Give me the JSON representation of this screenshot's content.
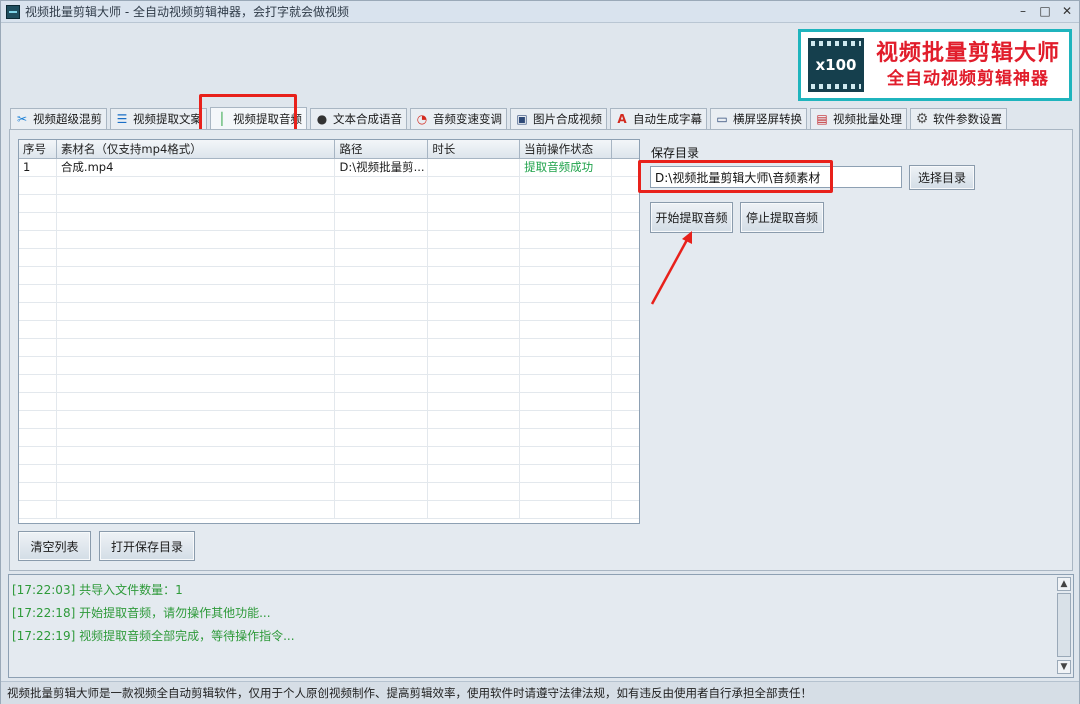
{
  "window": {
    "title": "视频批量剪辑大师 - 全自动视频剪辑神器，会打字就会做视频",
    "minimize": "–",
    "maximize": "□",
    "close": "✕"
  },
  "banner": {
    "badge": "x100",
    "line1": "视频批量剪辑大师",
    "line2": "全自动视频剪辑神器"
  },
  "tabs": [
    {
      "label": "视频超级混剪",
      "icon": "scissors-icon",
      "glyph": "✂"
    },
    {
      "label": "视频提取文案",
      "icon": "document-icon",
      "glyph": "☰"
    },
    {
      "label": "视频提取音频",
      "icon": "audio-wave-icon",
      "glyph": "│",
      "active": true
    },
    {
      "label": "文本合成语音",
      "icon": "microphone-icon",
      "glyph": "●"
    },
    {
      "label": "音频变速变调",
      "icon": "gauge-icon",
      "glyph": "◔"
    },
    {
      "label": "图片合成视频",
      "icon": "image-icon",
      "glyph": "▣"
    },
    {
      "label": "自动生成字幕",
      "icon": "subtitle-icon",
      "glyph": "A"
    },
    {
      "label": "横屏竖屏转换",
      "icon": "rotate-icon",
      "glyph": "▭"
    },
    {
      "label": "视频批量处理",
      "icon": "film-icon",
      "glyph": "▤"
    },
    {
      "label": "软件参数设置",
      "icon": "gear-icon",
      "glyph": "⚙"
    }
  ],
  "table": {
    "headers": [
      "序号",
      "素材名（仅支持mp4格式）",
      "路径",
      "时长",
      "当前操作状态"
    ],
    "rows": [
      [
        "1",
        "合成.mp4",
        "D:\\视频批量剪...",
        "",
        "提取音频成功"
      ]
    ]
  },
  "buttons": {
    "clear_list": "清空列表",
    "open_save_dir": "打开保存目录",
    "choose_dir": "选择目录",
    "start_extract": "开始提取音频",
    "stop_extract": "停止提取音频"
  },
  "save": {
    "label": "保存目录",
    "value": "D:\\视频批量剪辑大师\\音频素材"
  },
  "log": [
    "[17:22:03] 共导入文件数量：1",
    "[17:22:18] 开始提取音频，请勿操作其他功能...",
    "[17:22:19] 视频提取音频全部完成，等待操作指令..."
  ],
  "status": "视频批量剪辑大师是一款视频全自动剪辑软件，仅用于个人原创视频制作、提高剪辑效率，使用软件时请遵守法律法规，如有违反由使用者自行承担全部责任！",
  "colors": {
    "highlight": "#e8211b",
    "success_text": "#1ea24a",
    "log_text": "#2e9a3a",
    "banner_border": "#1fb4bd",
    "banner_text": "#e11d2b"
  }
}
